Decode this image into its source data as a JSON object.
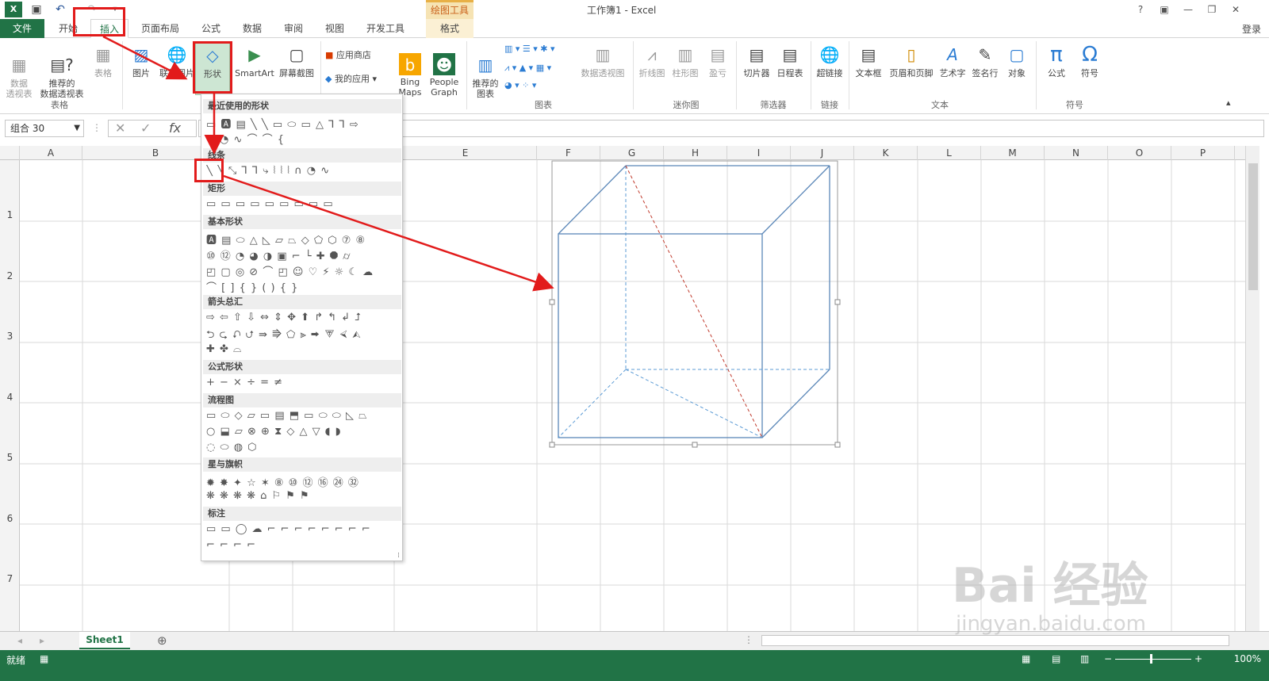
{
  "app": {
    "window_title": "工作簿1 - Excel",
    "contextual_tab_title": "绘图工具",
    "signin": "登录",
    "accent_color": "#217346"
  },
  "titlebar": {
    "excel_icon": "X",
    "help": "?"
  },
  "tabs": [
    {
      "label": "文件"
    },
    {
      "label": "开始"
    },
    {
      "label": "插入"
    },
    {
      "label": "页面布局"
    },
    {
      "label": "公式"
    },
    {
      "label": "数据"
    },
    {
      "label": "审阅"
    },
    {
      "label": "视图"
    },
    {
      "label": "开发工具"
    },
    {
      "label": "格式"
    }
  ],
  "ribbon": {
    "pivot_table": "数据\n透视表",
    "rec_pivot": "推荐的\n数据透视表",
    "table": "表格",
    "group_tables": "表格",
    "picture": "图片",
    "online_picture": "联机图片",
    "shapes": "形状",
    "smartart": "SmartArt",
    "screenshot": "屏幕截图",
    "store": "应用商店",
    "my_apps": "我的应用",
    "bing_maps": "Bing\nMaps",
    "people_graph": "People\nGraph",
    "rec_charts": "推荐的\n图表",
    "group_charts": "图表",
    "pivot_chart": "数据透视图",
    "line": "折线图",
    "column": "柱形图",
    "winloss": "盈亏",
    "group_sparklines": "迷你图",
    "slicer": "切片器",
    "timeline": "日程表",
    "group_filters": "筛选器",
    "hyperlink": "超链接",
    "group_links": "链接",
    "textbox": "文本框",
    "header_footer": "页眉和页脚",
    "wordart": "艺术字",
    "signature": "签名行",
    "object": "对象",
    "group_text": "文本",
    "equation": "公式",
    "symbol": "符号",
    "group_symbols": "符号"
  },
  "formula_bar": {
    "name_box": "组合 30",
    "fx": "fx"
  },
  "columns": [
    "A",
    "B",
    "C",
    "D",
    "E",
    "F",
    "G",
    "H",
    "I",
    "J",
    "K",
    "L",
    "M",
    "N",
    "O",
    "P"
  ],
  "rows": [
    "1",
    "2",
    "3",
    "4",
    "5",
    "6",
    "7"
  ],
  "gallery": {
    "sections": [
      {
        "title": "最近使用的形状",
        "rows": [
          "▭ 🅰 ▤ ╲ ╲ ▭ ⬭ ▭ △ ⅂ ⅂ ⇨",
          "⇩ ◔ ∿ ⌒ ⌒ {"
        ]
      },
      {
        "title": "线条",
        "rows": [
          "╲ ╲ ⤡ ⅂ ⅂ ⤷ ⦚ ⦚ ⦚ ∩ ◔ ∿"
        ]
      },
      {
        "title": "矩形",
        "rows": [
          "▭ ▭ ▭ ▭ ▭ ▭ ▭ ▭ ▭"
        ]
      },
      {
        "title": "基本形状",
        "rows": [
          "🅰 ▤ ⬭ △ ◺ ▱ ⏢ ◇ ⬠ ⬡ ⑦ ⑧",
          "⑩ ⑫ ◔ ◕ ◑ ▣ ⌐ └ ✚ ⯃ ⌭",
          "◰ ▢ ◎ ⊘ ⌒ ◰ ☺ ♡ ⚡ ☼ ☾ ☁",
          "⌒ [ ] { } ( ) { }"
        ]
      },
      {
        "title": "箭头总汇",
        "rows": [
          "⇨ ⇦ ⇧ ⇩ ⇔ ⇕ ✥ ⬆ ↱ ↰ ↲ ⮥",
          "⮌ ⮎ ⮏ ⮍ ⇛ ⭆ ⬠ ⫸ ⮕ ⮗ ⮘ ⮙",
          "✚ ✤ ⌓"
        ]
      },
      {
        "title": "公式形状",
        "rows": [
          "+ − × ÷ = ≠"
        ]
      },
      {
        "title": "流程图",
        "rows": [
          "▭ ⬭ ◇ ▱ ▭ ▤ ⬒ ▭ ⬭ ⬭ ◺ ⏢",
          "○ ⬓ ▱ ⊗ ⊕ ⧗ ◇ △ ▽ ◖ ◗",
          "◌ ⬭ ◍ ⬡"
        ]
      },
      {
        "title": "星与旗帜",
        "rows": [
          "✹ ✸ ✦ ☆ ✶ ⑧ ⑩ ⑫ ⑯ ㉔ ㉜",
          "❋ ❋ ❋ ❋ ⌂ ⚐ ⚑ ⚑"
        ]
      },
      {
        "title": "标注",
        "rows": [
          "▭ ▭ ◯ ☁ ⌐ ⌐ ⌐ ⌐ ⌐ ⌐ ⌐ ⌐",
          "⌐ ⌐ ⌐ ⌐"
        ]
      }
    ]
  },
  "sheetbar": {
    "sheet_name": "Sheet1",
    "add": "⊕"
  },
  "status": {
    "ready": "就绪",
    "zoom": "100%"
  },
  "watermark": {
    "main": "Bai  经验",
    "sub": "jingyan.baidu.com"
  }
}
